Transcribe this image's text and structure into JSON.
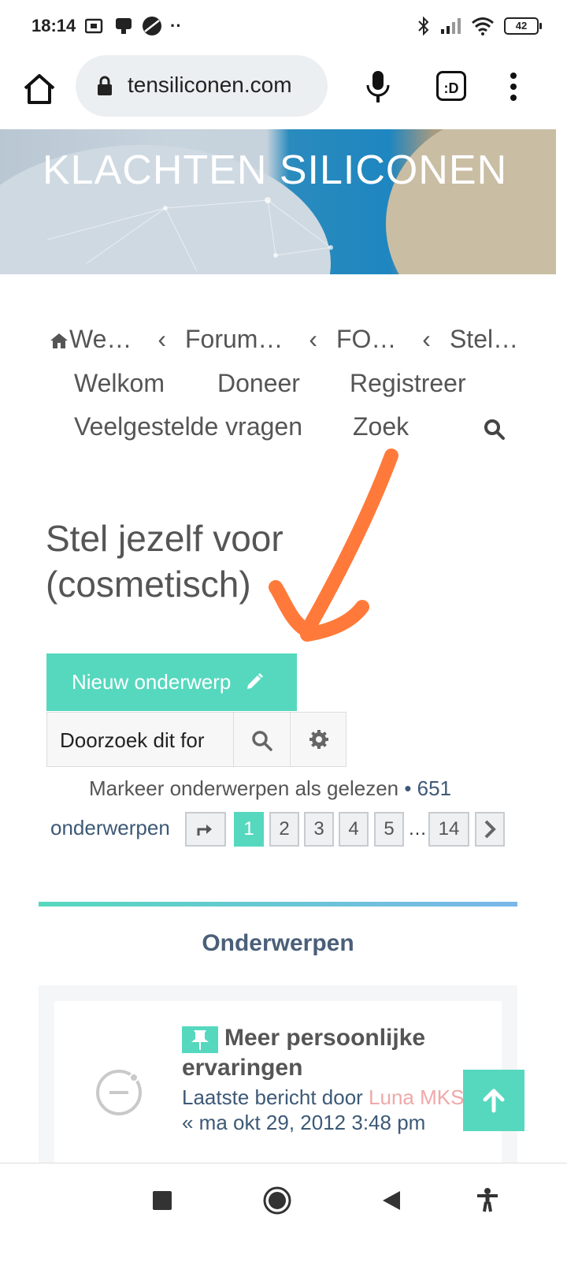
{
  "status_bar": {
    "time": "18:14",
    "battery": "42",
    "icons": [
      "vpn-icon",
      "notification-icon",
      "app-icon",
      "more-dots-icon",
      "bluetooth-icon",
      "signal-icon",
      "wifi-icon",
      "battery-icon"
    ]
  },
  "browser": {
    "url": "tensiliconen.com",
    "tab_label": ":D"
  },
  "banner": {
    "title": "KLACHTEN SILICONEN"
  },
  "breadcrumb": [
    "We…",
    "Forum…",
    "FO…",
    "Stel…"
  ],
  "nav": {
    "welkom": "Welkom",
    "doneer": "Doneer",
    "registreer": "Registreer",
    "faq": "Veelgestelde vragen",
    "zoek": "Zoek"
  },
  "page_title": "Stel jezelf voor (cosmetisch)",
  "new_topic_label": "Nieuw onderwerp",
  "search": {
    "value": "Doorzoek dit for"
  },
  "mark_read": "Markeer onderwerpen als gelezen",
  "topics_count": "• 651",
  "topics_label": "onderwerpen",
  "pagination": {
    "pages": [
      "1",
      "2",
      "3",
      "4",
      "5"
    ],
    "ellipsis": "…",
    "last": "14",
    "active": "1"
  },
  "section_title": "Onderwerpen",
  "topic": {
    "title": "Meer persoonlijke ervaringen",
    "meta_prefix": "Laatste bericht door",
    "author": "Luna MKS",
    "date": "« ma okt 29, 2012 3:48 pm"
  },
  "colors": {
    "accent": "#56d8be",
    "annotation": "#ff7a3a",
    "link": "#3d5976"
  }
}
